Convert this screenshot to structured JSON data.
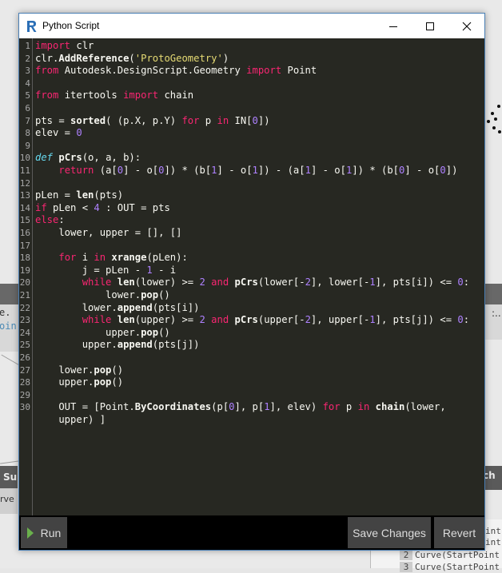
{
  "window": {
    "title": "Python Script",
    "app_icon": "dynamo-icon",
    "controls": [
      "minimize-icon",
      "maximize-icon",
      "close-icon"
    ]
  },
  "theme": {
    "editor_bg": "#272822",
    "keyword": "#f92672",
    "def_keyword": "#66d9ef",
    "number": "#ae81ff",
    "string": "#e6db74",
    "text": "#f8f8f2",
    "run_icon": "#6ab04c"
  },
  "editor": {
    "line_numbers": [
      "1",
      "2",
      "3",
      "4",
      "5",
      "6",
      "7",
      "8",
      "9",
      "10",
      "11",
      "12",
      "13",
      "14",
      "15",
      "16",
      "17",
      "18",
      "19",
      "20",
      "21",
      "22",
      "23",
      "24",
      "25",
      "26",
      "27",
      "28",
      "29",
      "30"
    ],
    "lines": [
      [
        {
          "t": "kw",
          "v": "import"
        },
        {
          "t": "p",
          "v": " clr"
        }
      ],
      [
        {
          "t": "p",
          "v": "clr."
        },
        {
          "t": "fn",
          "v": "AddReference"
        },
        {
          "t": "p",
          "v": "("
        },
        {
          "t": "str",
          "v": "'ProtoGeometry'"
        },
        {
          "t": "p",
          "v": ")"
        }
      ],
      [
        {
          "t": "kw",
          "v": "from"
        },
        {
          "t": "p",
          "v": " Autodesk.DesignScript.Geometry "
        },
        {
          "t": "kw",
          "v": "import"
        },
        {
          "t": "p",
          "v": " Point"
        }
      ],
      [],
      [
        {
          "t": "kw",
          "v": "from"
        },
        {
          "t": "p",
          "v": " itertools "
        },
        {
          "t": "kw",
          "v": "import"
        },
        {
          "t": "p",
          "v": " chain"
        }
      ],
      [],
      [
        {
          "t": "p",
          "v": "pts = "
        },
        {
          "t": "fn",
          "v": "sorted"
        },
        {
          "t": "p",
          "v": "( (p.X, p.Y) "
        },
        {
          "t": "kw",
          "v": "for"
        },
        {
          "t": "p",
          "v": " p "
        },
        {
          "t": "kw",
          "v": "in"
        },
        {
          "t": "p",
          "v": " IN["
        },
        {
          "t": "num",
          "v": "0"
        },
        {
          "t": "p",
          "v": "])"
        }
      ],
      [
        {
          "t": "p",
          "v": "elev = "
        },
        {
          "t": "num",
          "v": "0"
        }
      ],
      [],
      [
        {
          "t": "def",
          "v": "def"
        },
        {
          "t": "p",
          "v": " "
        },
        {
          "t": "fn",
          "v": "pCrs"
        },
        {
          "t": "p",
          "v": "(o, a, b):"
        }
      ],
      [
        {
          "t": "p",
          "v": "    "
        },
        {
          "t": "kw",
          "v": "return"
        },
        {
          "t": "p",
          "v": " (a["
        },
        {
          "t": "num",
          "v": "0"
        },
        {
          "t": "p",
          "v": "] - o["
        },
        {
          "t": "num",
          "v": "0"
        },
        {
          "t": "p",
          "v": "]) * (b["
        },
        {
          "t": "num",
          "v": "1"
        },
        {
          "t": "p",
          "v": "] - o["
        },
        {
          "t": "num",
          "v": "1"
        },
        {
          "t": "p",
          "v": "]) - (a["
        },
        {
          "t": "num",
          "v": "1"
        },
        {
          "t": "p",
          "v": "] - o["
        },
        {
          "t": "num",
          "v": "1"
        },
        {
          "t": "p",
          "v": "]) * (b["
        },
        {
          "t": "num",
          "v": "0"
        },
        {
          "t": "p",
          "v": "] - o["
        },
        {
          "t": "num",
          "v": "0"
        },
        {
          "t": "p",
          "v": "])"
        }
      ],
      [],
      [
        {
          "t": "p",
          "v": "pLen = "
        },
        {
          "t": "fn",
          "v": "len"
        },
        {
          "t": "p",
          "v": "(pts)"
        }
      ],
      [
        {
          "t": "kw",
          "v": "if"
        },
        {
          "t": "p",
          "v": " pLen < "
        },
        {
          "t": "num",
          "v": "4"
        },
        {
          "t": "p",
          "v": " : OUT = pts"
        }
      ],
      [
        {
          "t": "kw",
          "v": "else"
        },
        {
          "t": "p",
          "v": ":"
        }
      ],
      [
        {
          "t": "p",
          "v": "    lower, upper = [], []"
        }
      ],
      [],
      [
        {
          "t": "p",
          "v": "    "
        },
        {
          "t": "kw",
          "v": "for"
        },
        {
          "t": "p",
          "v": " i "
        },
        {
          "t": "kw",
          "v": "in"
        },
        {
          "t": "p",
          "v": " "
        },
        {
          "t": "fn",
          "v": "xrange"
        },
        {
          "t": "p",
          "v": "(pLen):"
        }
      ],
      [
        {
          "t": "p",
          "v": "        j = pLen - "
        },
        {
          "t": "num",
          "v": "1"
        },
        {
          "t": "p",
          "v": " - i"
        }
      ],
      [
        {
          "t": "p",
          "v": "        "
        },
        {
          "t": "kw",
          "v": "while"
        },
        {
          "t": "p",
          "v": " "
        },
        {
          "t": "fn",
          "v": "len"
        },
        {
          "t": "p",
          "v": "(lower) >= "
        },
        {
          "t": "num",
          "v": "2"
        },
        {
          "t": "p",
          "v": " "
        },
        {
          "t": "kw",
          "v": "and"
        },
        {
          "t": "p",
          "v": " "
        },
        {
          "t": "fn",
          "v": "pCrs"
        },
        {
          "t": "p",
          "v": "(lower[-"
        },
        {
          "t": "num",
          "v": "2"
        },
        {
          "t": "p",
          "v": "], lower[-"
        },
        {
          "t": "num",
          "v": "1"
        },
        {
          "t": "p",
          "v": "], pts[i]) <= "
        },
        {
          "t": "num",
          "v": "0"
        },
        {
          "t": "p",
          "v": ":"
        }
      ],
      [
        {
          "t": "p",
          "v": "            lower."
        },
        {
          "t": "fn",
          "v": "pop"
        },
        {
          "t": "p",
          "v": "()"
        }
      ],
      [
        {
          "t": "p",
          "v": "        lower."
        },
        {
          "t": "fn",
          "v": "append"
        },
        {
          "t": "p",
          "v": "(pts[i])"
        }
      ],
      [
        {
          "t": "p",
          "v": "        "
        },
        {
          "t": "kw",
          "v": "while"
        },
        {
          "t": "p",
          "v": " "
        },
        {
          "t": "fn",
          "v": "len"
        },
        {
          "t": "p",
          "v": "(upper) >= "
        },
        {
          "t": "num",
          "v": "2"
        },
        {
          "t": "p",
          "v": " "
        },
        {
          "t": "kw",
          "v": "and"
        },
        {
          "t": "p",
          "v": " "
        },
        {
          "t": "fn",
          "v": "pCrs"
        },
        {
          "t": "p",
          "v": "(upper[-"
        },
        {
          "t": "num",
          "v": "2"
        },
        {
          "t": "p",
          "v": "], upper[-"
        },
        {
          "t": "num",
          "v": "1"
        },
        {
          "t": "p",
          "v": "], pts[j]) <= "
        },
        {
          "t": "num",
          "v": "0"
        },
        {
          "t": "p",
          "v": ":"
        }
      ],
      [
        {
          "t": "p",
          "v": "            upper."
        },
        {
          "t": "fn",
          "v": "pop"
        },
        {
          "t": "p",
          "v": "()"
        }
      ],
      [
        {
          "t": "p",
          "v": "        upper."
        },
        {
          "t": "fn",
          "v": "append"
        },
        {
          "t": "p",
          "v": "(pts[j])"
        }
      ],
      [],
      [
        {
          "t": "p",
          "v": "    lower."
        },
        {
          "t": "fn",
          "v": "pop"
        },
        {
          "t": "p",
          "v": "()"
        }
      ],
      [
        {
          "t": "p",
          "v": "    upper."
        },
        {
          "t": "fn",
          "v": "pop"
        },
        {
          "t": "p",
          "v": "()"
        }
      ],
      [],
      [
        {
          "t": "p",
          "v": "    OUT = [Point."
        },
        {
          "t": "fn",
          "v": "ByCoordinates"
        },
        {
          "t": "p",
          "v": "(p["
        },
        {
          "t": "num",
          "v": "0"
        },
        {
          "t": "p",
          "v": "], p["
        },
        {
          "t": "num",
          "v": "1"
        },
        {
          "t": "p",
          "v": "], elev) "
        },
        {
          "t": "kw",
          "v": "for"
        },
        {
          "t": "p",
          "v": " p "
        },
        {
          "t": "kw",
          "v": "in"
        },
        {
          "t": "p",
          "v": " "
        },
        {
          "t": "fn",
          "v": "chain"
        },
        {
          "t": "p",
          "v": "(lower,"
        }
      ],
      [
        {
          "t": "p",
          "v": "    upper) ]"
        }
      ]
    ]
  },
  "footer": {
    "run_label": "Run",
    "save_label": "Save Changes",
    "revert_label": "Revert"
  },
  "background": {
    "left_node_line1": "e.",
    "left_node_line2": "oin",
    "right_node_text": ":..",
    "sum_node_title": "Su",
    "sum_node_sub": "rve",
    "ch_node_title": "ch",
    "list_rows": [
      {
        "index": "",
        "text": "int"
      },
      {
        "index": "",
        "text": "int"
      },
      {
        "index": "2",
        "text": "Curve(StartPoint"
      },
      {
        "index": "3",
        "text": "Curve(StartPoint"
      }
    ]
  }
}
